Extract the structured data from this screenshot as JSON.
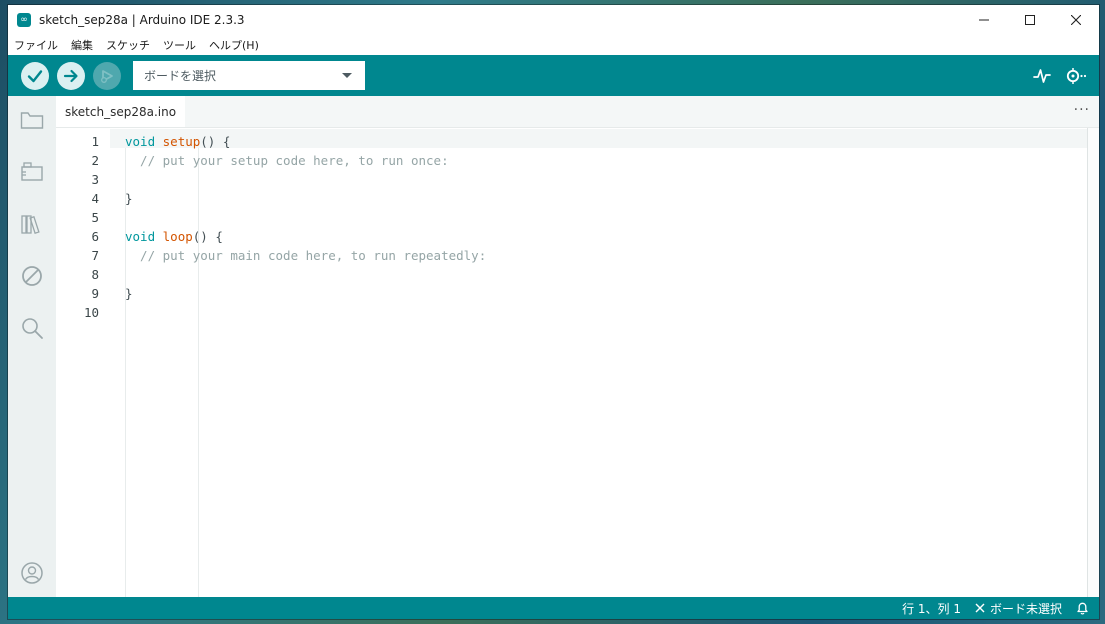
{
  "window": {
    "title": "sketch_sep28a | Arduino IDE 2.3.3"
  },
  "menu": [
    "ファイル",
    "編集",
    "スケッチ",
    "ツール",
    "ヘルプ(H)"
  ],
  "toolbar": {
    "board_select_label": "ボードを選択"
  },
  "tabs": [
    {
      "label": "sketch_sep28a.ino"
    }
  ],
  "editor": {
    "line_numbers": [
      "1",
      "2",
      "3",
      "4",
      "5",
      "6",
      "7",
      "8",
      "9",
      "10"
    ],
    "lines": [
      {
        "kw": "void",
        "fn": "setup",
        "rest": "() {"
      },
      {
        "comment": "  // put your setup code here, to run once:"
      },
      {
        "text": ""
      },
      {
        "text": "}"
      },
      {
        "text": ""
      },
      {
        "kw": "void",
        "fn": "loop",
        "rest": "() {"
      },
      {
        "comment": "  // put your main code here, to run repeatedly:"
      },
      {
        "text": ""
      },
      {
        "text": "}"
      },
      {
        "text": ""
      }
    ]
  },
  "status": {
    "cursor": "行 1、列 1",
    "board": "ボード未選択"
  },
  "colors": {
    "accent": "#00878f",
    "keyword": "#00979d",
    "function": "#d35400",
    "comment": "#95a5a6"
  },
  "icons": {
    "toolbar": [
      "verify-icon",
      "upload-icon",
      "debug-icon",
      "dropdown-arrow-icon",
      "serial-plotter-icon",
      "serial-monitor-icon"
    ],
    "sidebar": [
      "sketchbook-icon",
      "boards-manager-icon",
      "library-manager-icon",
      "debug-disabled-icon",
      "search-icon",
      "profile-icon"
    ]
  }
}
